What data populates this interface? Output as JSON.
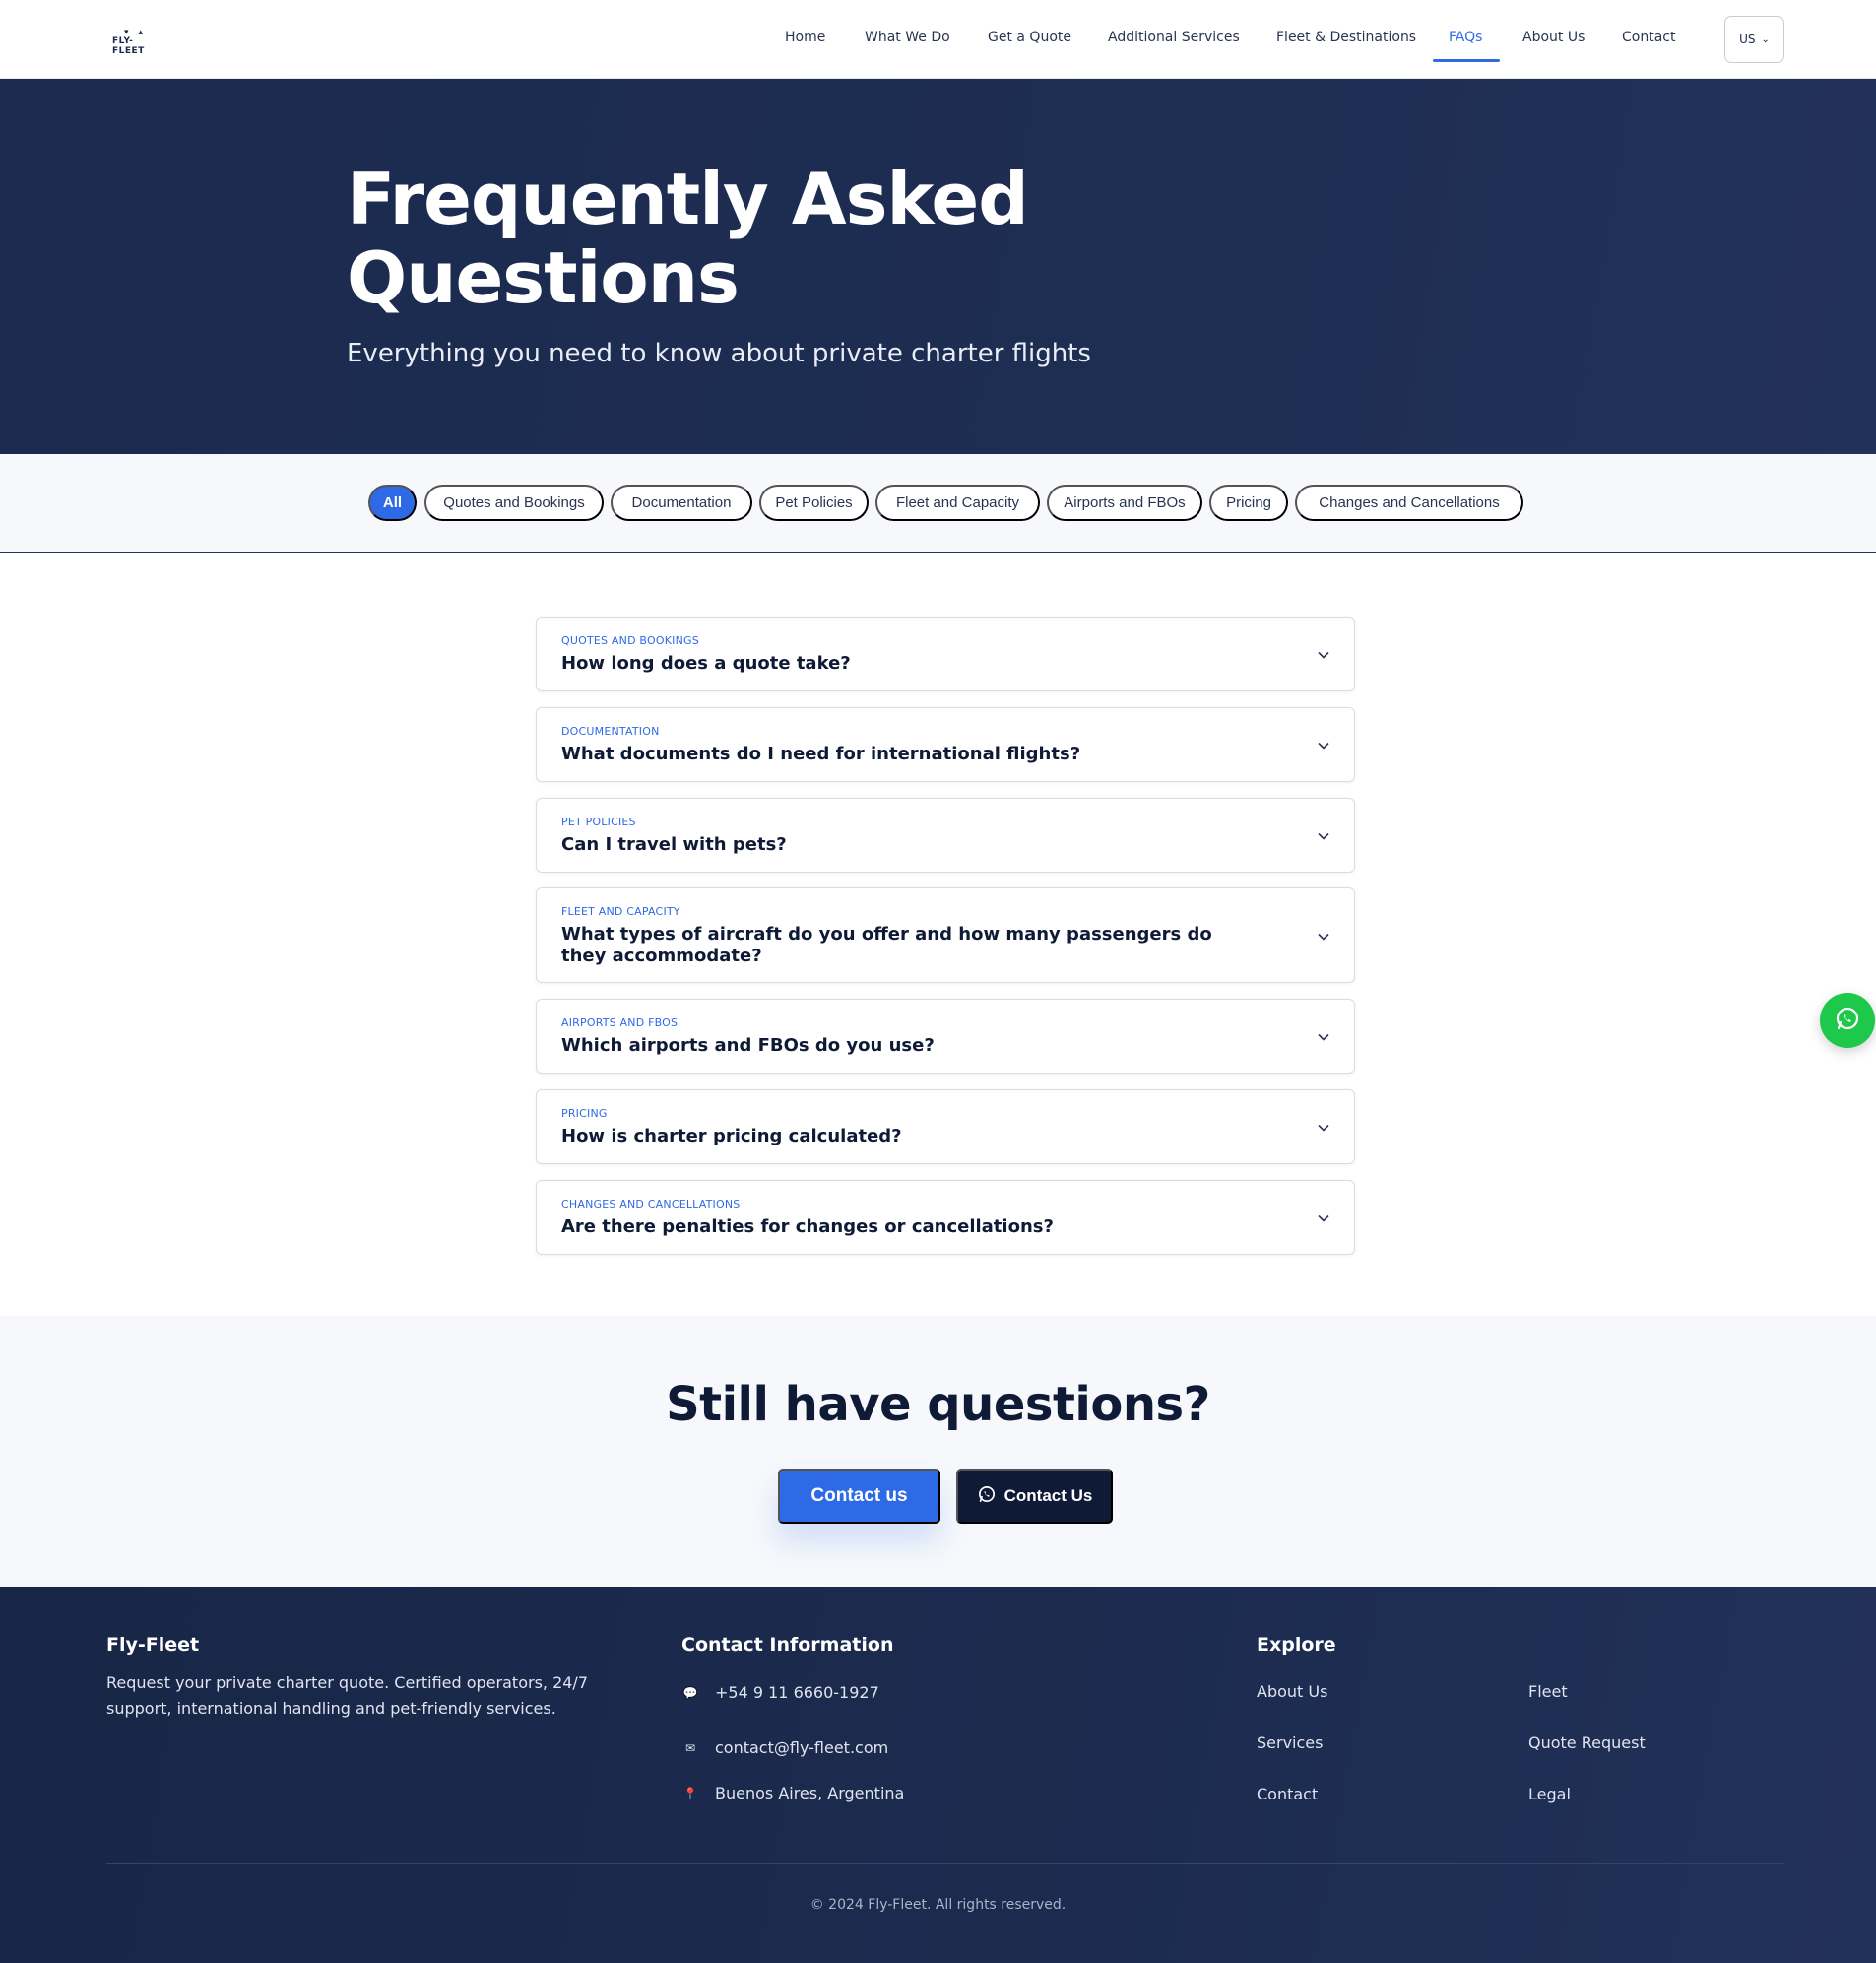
{
  "nav": {
    "logo": "FLY-FLEET",
    "links": [
      {
        "label": "Home"
      },
      {
        "label": "What We Do"
      },
      {
        "label": "Get a Quote"
      },
      {
        "label": "Additional Services"
      },
      {
        "label": "Fleet & Destinations"
      },
      {
        "label": "FAQs",
        "active": true
      },
      {
        "label": "About Us"
      },
      {
        "label": "Contact"
      }
    ],
    "language": "US"
  },
  "hero": {
    "title": "Frequently Asked Questions",
    "subtitle": "Everything you need to know about private charter flights"
  },
  "filters": [
    {
      "label": "All",
      "active": true
    },
    {
      "label": "Quotes and Bookings"
    },
    {
      "label": "Documentation"
    },
    {
      "label": "Pet Policies"
    },
    {
      "label": "Fleet and Capacity"
    },
    {
      "label": "Airports and FBOs"
    },
    {
      "label": "Pricing"
    },
    {
      "label": "Changes and Cancellations"
    }
  ],
  "faqs": [
    {
      "category": "Quotes and Bookings",
      "question": "How long does a quote take?"
    },
    {
      "category": "Documentation",
      "question": "What documents do I need for international flights?"
    },
    {
      "category": "Pet Policies",
      "question": "Can I travel with pets?"
    },
    {
      "category": "Fleet and Capacity",
      "question": "What types of aircraft do you offer and how many passengers do they accommodate?"
    },
    {
      "category": "Airports and FBOs",
      "question": "Which airports and FBOs do you use?"
    },
    {
      "category": "Pricing",
      "question": "How is charter pricing calculated?"
    },
    {
      "category": "Changes and Cancellations",
      "question": "Are there penalties for changes or cancellations?"
    }
  ],
  "cta": {
    "title": "Still have questions?",
    "contact_label": "Contact us",
    "whatsapp_label": "Contact Us"
  },
  "footer": {
    "brand": {
      "title": "Fly-Fleet",
      "description": "Request your private charter quote. Certified operators, 24/7 support, international handling and pet-friendly services."
    },
    "contact": {
      "title": "Contact Information",
      "phone": "+54 9 11 6660-1927",
      "email": "contact@fly-fleet.com",
      "location": "Buenos Aires, Argentina"
    },
    "explore": {
      "title": "Explore",
      "links": [
        "About Us",
        "Fleet",
        "Services",
        "Quote Request",
        "Contact",
        "Legal"
      ]
    },
    "copyright": "© 2024 Fly-Fleet. All rights reserved."
  },
  "colors": {
    "accent": "#2e6ae6",
    "navy": "#0f1b36",
    "hero_bg": "#1b2a4e",
    "whatsapp": "#1ec84a"
  }
}
